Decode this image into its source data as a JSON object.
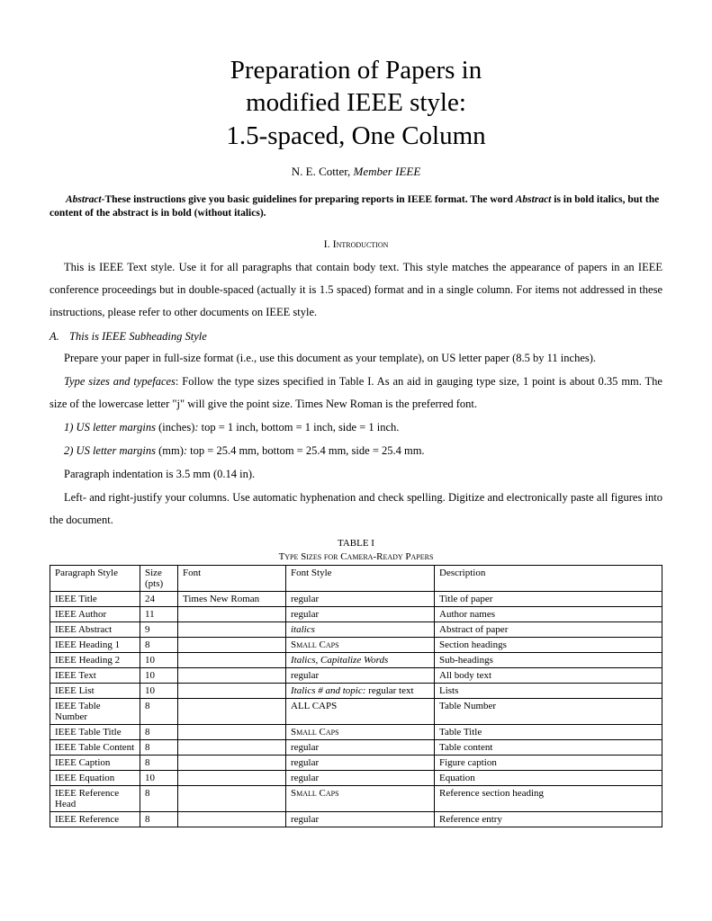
{
  "title_line1": "Preparation of Papers in",
  "title_line2": "modified IEEE style:",
  "title_line3": "1.5-spaced, One Column",
  "author_name": "N. E. Cotter, ",
  "author_suffix": "Member IEEE",
  "abstract_label": "Abstract-",
  "abstract_text": "These instructions give you basic guidelines for preparing reports in IEEE format.  The word ",
  "abstract_word": "Abstract",
  "abstract_tail": " is in bold italics, but the content of the abstract is in bold (without italics).",
  "sec1_num": "I.  ",
  "sec1_title": "Introduction",
  "para_intro": "This is IEEE Text style.  Use it for all paragraphs that contain body text.  This style matches the appearance of papers in an IEEE conference proceedings but in double-spaced (actually it is 1.5 spaced) format and in a single column.  For items not addressed in these instructions, please refer to other documents on IEEE style.",
  "subA_letter": "A.",
  "subA_title": "This is IEEE Subheading Style",
  "para_A1": "Prepare your paper in full-size format (i.e., use this document as your template), on US letter paper (8.5 by 11 inches).",
  "para_A2_lead": "Type sizes and typefaces",
  "para_A2_rest": ": Follow the type sizes specified in Table I. As an aid in gauging type size, 1 point is about 0.35 mm. The size of the lowercase letter \"j\" will give the point size. Times New Roman is the preferred font.",
  "para_A3_lead": "1) US letter margins ",
  "para_A3_mid": "(inches)",
  "para_A3_rest": ": top = 1 inch, bottom = 1 inch, side = 1 inch.",
  "para_A4_lead": "2) US letter margins ",
  "para_A4_mid": "(mm)",
  "para_A4_rest": ": top = 25.4 mm, bottom = 25.4 mm, side = 25.4 mm.",
  "para_A5": "Paragraph indentation is 3.5 mm (0.14 in).",
  "para_A6": "Left- and right-justify your columns.  Use automatic hyphenation and check spelling.  Digitize and electronically paste all figures into the document.",
  "table_num": "TABLE I",
  "table_title": "Type Sizes for Camera-Ready Papers",
  "table_headers": [
    "Paragraph Style",
    "Size (pts)",
    "Font",
    "Font Style",
    "Description"
  ],
  "table_rows": [
    {
      "style": "IEEE Title",
      "size": "24",
      "font": "Times New Roman",
      "fstyle": "regular",
      "fstyle_class": "",
      "desc": "Title of paper"
    },
    {
      "style": "IEEE Author",
      "size": "11",
      "font": "",
      "fstyle": "regular",
      "fstyle_class": "",
      "desc": "Author names"
    },
    {
      "style": "IEEE Abstract",
      "size": "9",
      "font": "",
      "fstyle": "italics",
      "fstyle_class": "italic-cell",
      "desc": "Abstract of paper"
    },
    {
      "style": "IEEE Heading 1",
      "size": "8",
      "font": "",
      "fstyle": "Small Caps",
      "fstyle_class": "sc",
      "desc": "Section headings"
    },
    {
      "style": "IEEE Heading 2",
      "size": "10",
      "font": "",
      "fstyle": "Italics, Capitalize Words",
      "fstyle_class": "italic-cell",
      "desc": "Sub-headings"
    },
    {
      "style": "IEEE Text",
      "size": "10",
      "font": "",
      "fstyle": "regular",
      "fstyle_class": "",
      "desc": "All body text"
    },
    {
      "style": "IEEE List",
      "size": "10",
      "font": "",
      "fstyle_html": "<span class=\"italic-cell\">Italics # and topic:</span> regular text",
      "desc": "Lists"
    },
    {
      "style": "IEEE Table Number",
      "size": "8",
      "font": "",
      "fstyle": "ALL CAPS",
      "fstyle_class": "",
      "desc": "Table Number"
    },
    {
      "style": "IEEE Table Title",
      "size": "8",
      "font": "",
      "fstyle": "Small Caps",
      "fstyle_class": "sc",
      "desc": "Table Title"
    },
    {
      "style": "IEEE Table Content",
      "size": "8",
      "font": "",
      "fstyle": "regular",
      "fstyle_class": "",
      "desc": "Table content"
    },
    {
      "style": "IEEE Caption",
      "size": "8",
      "font": "",
      "fstyle": "regular",
      "fstyle_class": "",
      "desc": "Figure caption"
    },
    {
      "style": "IEEE Equation",
      "size": "10",
      "font": "",
      "fstyle": "regular",
      "fstyle_class": "",
      "desc": "Equation"
    },
    {
      "style": "IEEE Reference Head",
      "size": "8",
      "font": "",
      "fstyle": "Small Caps",
      "fstyle_class": "sc",
      "desc": "Reference section heading"
    },
    {
      "style": "IEEE Reference",
      "size": "8",
      "font": "",
      "fstyle": "regular",
      "fstyle_class": "",
      "desc": "Reference entry"
    }
  ]
}
